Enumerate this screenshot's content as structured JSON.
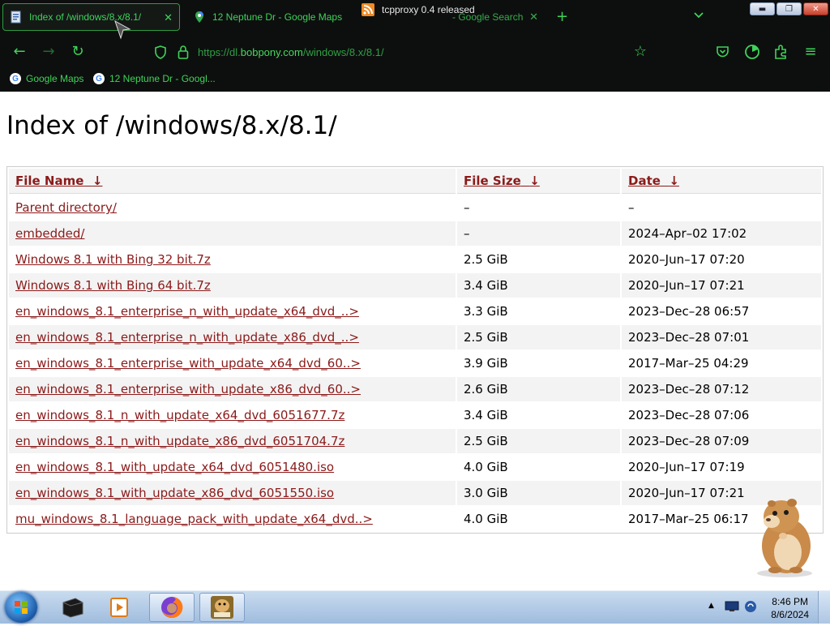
{
  "browser": {
    "tabs": [
      {
        "label": "Index of /windows/8.x/8.1/",
        "active": true
      },
      {
        "label": "12 Neptune Dr - Google Maps",
        "active": false
      },
      {
        "label": "- Google Search",
        "active": false
      }
    ],
    "notification": "tcpproxy 0.4 released",
    "url_prefix": "https://dl.",
    "url_domain": "bobpony.com",
    "url_path": "/windows/8.x/8.1/",
    "bookmarks": [
      "Google Maps",
      "12 Neptune Dr - Googl..."
    ],
    "accent_color": "#3fd35a"
  },
  "page": {
    "title": "Index of /windows/8.x/8.1/",
    "headers": {
      "name": "File Name",
      "size": "File Size",
      "date": "Date",
      "sort_arrow": "↓"
    },
    "rows": [
      {
        "name": "Parent directory/",
        "size": "–",
        "date": "–"
      },
      {
        "name": "embedded/",
        "size": "–",
        "date": "2024–Apr–02 17:02"
      },
      {
        "name": "Windows 8.1 with Bing 32 bit.7z",
        "size": "2.5 GiB",
        "date": "2020–Jun–17 07:20"
      },
      {
        "name": "Windows 8.1 with Bing 64 bit.7z",
        "size": "3.4 GiB",
        "date": "2020–Jun–17 07:21"
      },
      {
        "name": "en_windows_8.1_enterprise_n_with_update_x64_dvd_..>",
        "size": "3.3 GiB",
        "date": "2023–Dec–28 06:57"
      },
      {
        "name": "en_windows_8.1_enterprise_n_with_update_x86_dvd_..>",
        "size": "2.5 GiB",
        "date": "2023–Dec–28 07:01"
      },
      {
        "name": "en_windows_8.1_enterprise_with_update_x64_dvd_60..>",
        "size": "3.9 GiB",
        "date": "2017–Mar–25 04:29"
      },
      {
        "name": "en_windows_8.1_enterprise_with_update_x86_dvd_60..>",
        "size": "2.6 GiB",
        "date": "2023–Dec–28 07:12"
      },
      {
        "name": "en_windows_8.1_n_with_update_x64_dvd_6051677.7z",
        "size": "3.4 GiB",
        "date": "2023–Dec–28 07:06"
      },
      {
        "name": "en_windows_8.1_n_with_update_x86_dvd_6051704.7z",
        "size": "2.5 GiB",
        "date": "2023–Dec–28 07:09"
      },
      {
        "name": "en_windows_8.1_with_update_x64_dvd_6051480.iso",
        "size": "4.0 GiB",
        "date": "2020–Jun–17 07:19"
      },
      {
        "name": "en_windows_8.1_with_update_x86_dvd_6051550.iso",
        "size": "3.0 GiB",
        "date": "2020–Jun–17 07:21"
      },
      {
        "name": "mu_windows_8.1_language_pack_with_update_x64_dvd..>",
        "size": "4.0 GiB",
        "date": "2017–Mar–25 06:17"
      }
    ],
    "link_color": "#8b1a1a"
  },
  "taskbar": {
    "items": [
      "start-button",
      "window-icon",
      "media-player-icon",
      "firefox-icon",
      "hamster-box-icon"
    ],
    "time": "8:46 PM",
    "date": "8/6/2024"
  }
}
